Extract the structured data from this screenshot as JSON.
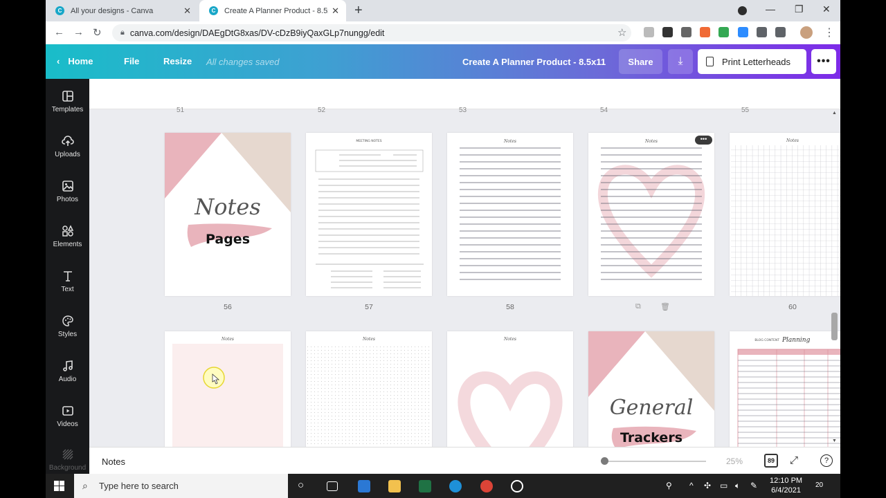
{
  "browser": {
    "tabs": [
      {
        "label": "All your designs - Canva"
      },
      {
        "label": "Create A Planner Product - 8.5x11"
      }
    ],
    "url": "canva.com/design/DAEgDtG8xas/DV-cDzB9iyQaxGLp7nungg/edit"
  },
  "canva_header": {
    "home": "Home",
    "file": "File",
    "resize": "Resize",
    "status": "All changes saved",
    "title": "Create A Planner Product - 8.5x11",
    "share": "Share",
    "print": "Print Letterheads"
  },
  "sidebar": {
    "items": [
      {
        "label": "Templates",
        "icon": "templates-icon"
      },
      {
        "label": "Uploads",
        "icon": "upload-cloud-icon"
      },
      {
        "label": "Photos",
        "icon": "image-icon"
      },
      {
        "label": "Elements",
        "icon": "shapes-icon"
      },
      {
        "label": "Text",
        "icon": "text-icon"
      },
      {
        "label": "Styles",
        "icon": "palette-icon"
      },
      {
        "label": "Audio",
        "icon": "music-note-icon"
      },
      {
        "label": "Videos",
        "icon": "video-icon"
      },
      {
        "label": "Background",
        "icon": "background-icon"
      }
    ]
  },
  "canvas": {
    "cut_numbers": [
      "51",
      "52",
      "53",
      "54",
      "55"
    ],
    "row1_numbers": [
      "56",
      "57",
      "58",
      "",
      "60"
    ],
    "page56": {
      "script": "Notes",
      "banner": "Pages"
    },
    "page57": {
      "header": "MEETING NOTES"
    },
    "page58": {
      "header": "Notes"
    },
    "page59": {
      "header": "Notes"
    },
    "page60": {
      "header": "Notes"
    },
    "page61": {
      "header": "Notes"
    },
    "page62": {
      "header": "Notes"
    },
    "page63": {
      "header": "Notes"
    },
    "page64": {
      "script": "General",
      "banner": "Trackers"
    },
    "page65": {
      "header_small": "BLOG CONTENT",
      "header_script": "Planning"
    }
  },
  "footer": {
    "notes": "Notes",
    "zoom": "25%",
    "page_count": "89",
    "help": "?"
  },
  "taskbar": {
    "search_placeholder": "Type here to search",
    "time": "12:10 PM",
    "date": "6/4/2021",
    "notifications": "20"
  },
  "colors": {
    "brand_gradient_start": "#19bdc9",
    "brand_gradient_end": "#7d2ae8",
    "pink": "#e9b4bc",
    "beige": "#e6d8cf"
  }
}
